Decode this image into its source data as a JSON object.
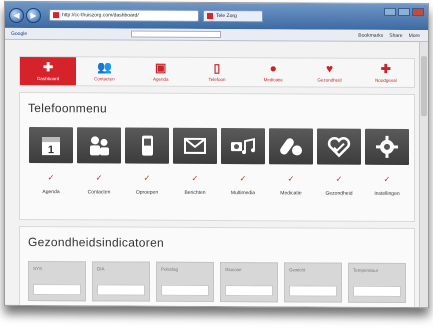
{
  "browser": {
    "address": "http://cc-thuiszorg.com/dashboard/",
    "tab_title": "Tele Zorg",
    "google_label": "Google",
    "tools": [
      "Bookmarks",
      "Share",
      "More"
    ]
  },
  "topnav": {
    "items": [
      {
        "label": "Dashboard",
        "icon": "plus-icon",
        "glyph": "✚"
      },
      {
        "label": "Contacten",
        "icon": "contacts-icon",
        "glyph": "👥"
      },
      {
        "label": "Agenda",
        "icon": "calendar-icon",
        "glyph": "▣"
      },
      {
        "label": "Telefoon",
        "icon": "phone-icon",
        "glyph": "▯"
      },
      {
        "label": "Medicatie",
        "icon": "pills-icon",
        "glyph": "●"
      },
      {
        "label": "Gezondheid",
        "icon": "heart-icon",
        "glyph": "♥"
      },
      {
        "label": "Noodgeval",
        "icon": "emergency-plus-icon",
        "glyph": "✚"
      }
    ]
  },
  "menu": {
    "title": "Telefoonmenu",
    "tiles": [
      {
        "label": "Agenda",
        "icon": "calendar-icon"
      },
      {
        "label": "Contacten",
        "icon": "contacts-icon"
      },
      {
        "label": "Oproepen",
        "icon": "phone-icon"
      },
      {
        "label": "Berichten",
        "icon": "envelope-icon"
      },
      {
        "label": "Multimedia",
        "icon": "camera-music-icon"
      },
      {
        "label": "Medicatie",
        "icon": "pills-icon"
      },
      {
        "label": "Gezondheid",
        "icon": "heart-icon"
      },
      {
        "label": "Instellingen",
        "icon": "gear-icon"
      }
    ],
    "check": "✓"
  },
  "health": {
    "title": "Gezondheidsindicatoren",
    "indicators": [
      {
        "label": "SYS",
        "value": ""
      },
      {
        "label": "DIA",
        "value": ""
      },
      {
        "label": "Polsslag",
        "value": ""
      },
      {
        "label": "Glucose",
        "value": ""
      },
      {
        "label": "Gewicht",
        "value": ""
      },
      {
        "label": "Temperatuur",
        "value": ""
      }
    ]
  },
  "colors": {
    "accent": "#d6232b",
    "tile": "#4a4a4a"
  }
}
